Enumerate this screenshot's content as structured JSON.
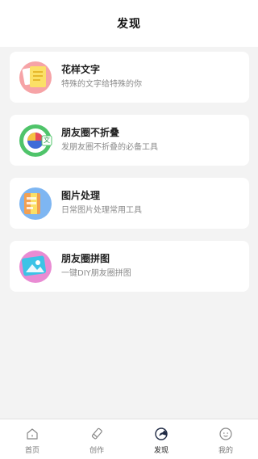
{
  "header": {
    "title": "发现"
  },
  "cards": [
    {
      "title": "花样文字",
      "subtitle": "特殊的文字给特殊的你",
      "icon": "note-icon"
    },
    {
      "title": "朋友圈不折叠",
      "subtitle": "发朋友圈不折叠的必备工具",
      "icon": "translate-icon",
      "icon_text": "文"
    },
    {
      "title": "图片处理",
      "subtitle": "日常图片处理常用工具",
      "icon": "document-icon"
    },
    {
      "title": "朋友圈拼图",
      "subtitle": "一键DIY朋友圈拼图",
      "icon": "image-icon"
    }
  ],
  "tabbar": {
    "active": "发现",
    "items": [
      {
        "label": "首页",
        "icon": "home-icon"
      },
      {
        "label": "创作",
        "icon": "pencil-icon"
      },
      {
        "label": "发现",
        "icon": "compass-icon"
      },
      {
        "label": "我的",
        "icon": "profile-icon"
      }
    ]
  },
  "colors": {
    "background": "#f3f3f3",
    "card": "#ffffff",
    "text": "#222222",
    "subtext": "#8a8a8a"
  }
}
